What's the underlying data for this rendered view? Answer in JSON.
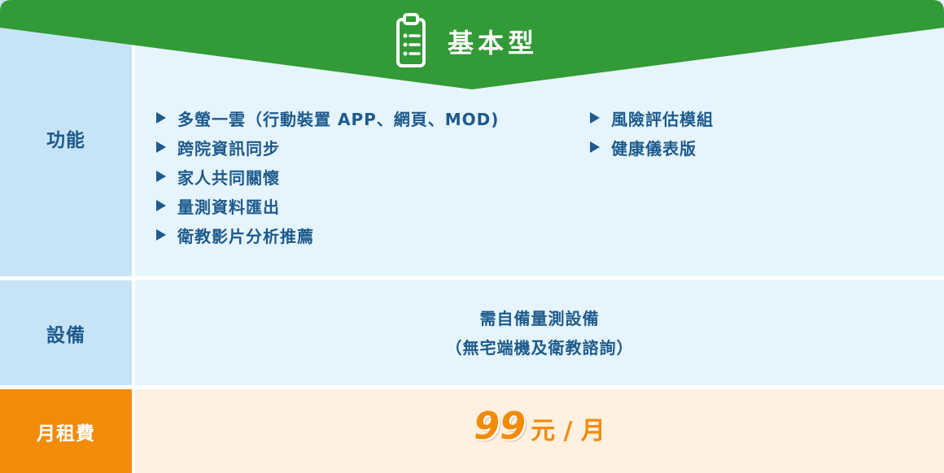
{
  "plan": {
    "title": "基本型"
  },
  "rows": {
    "features_label": "功能",
    "device_label": "設備",
    "price_label": "月租費"
  },
  "features": {
    "col1": [
      "多螢一雲（行動裝置 APP、網頁、MOD)",
      "跨院資訊同步",
      "家人共同關懷",
      "量測資料匯出",
      "衛教影片分析推薦"
    ],
    "col2": [
      "風險評估模組",
      "健康儀表版"
    ]
  },
  "device": {
    "line1": "需自備量測設備",
    "line2": "（無宅端機及衛教諮詢）"
  },
  "price": {
    "value": "99",
    "unit": "元 / 月"
  },
  "colors": {
    "banner": "#329a36",
    "label_bg": "#c7e4f6",
    "content_bg": "#e6f4fd",
    "accent_orange": "#f28b09",
    "text_blue": "#1e5a8c"
  },
  "icons": {
    "banner": "clipboard-list-icon",
    "bullet": "triangle-bullet-icon"
  }
}
